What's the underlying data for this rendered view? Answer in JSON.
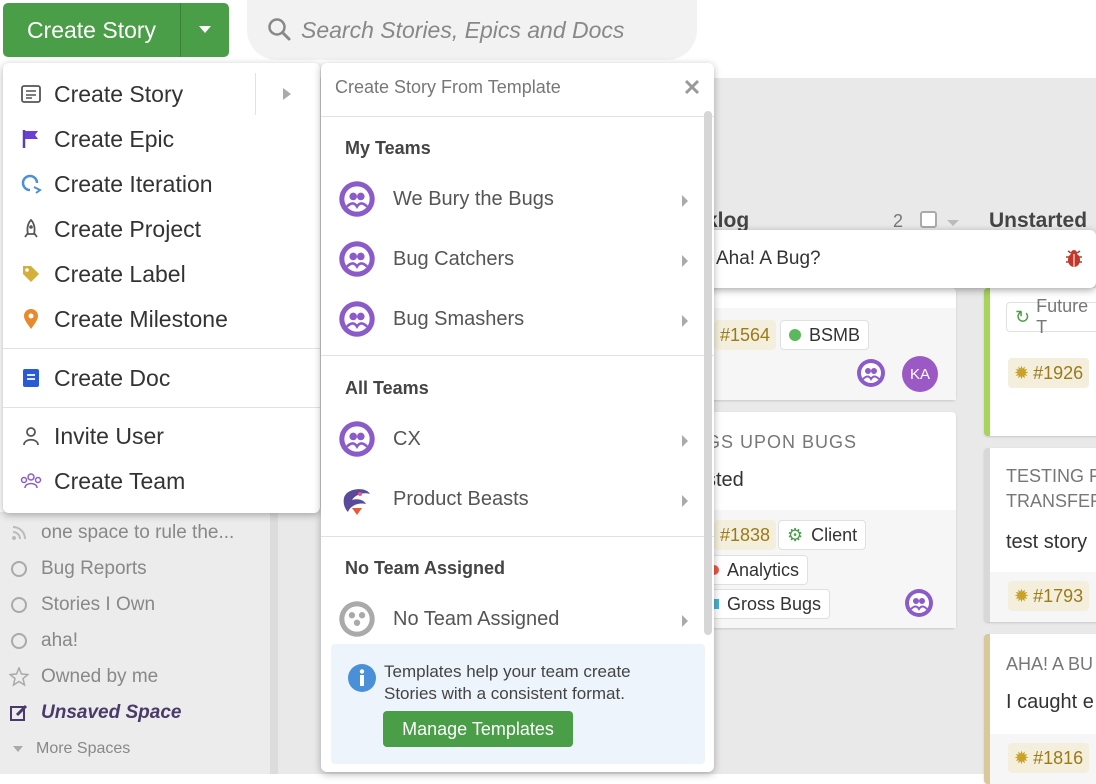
{
  "topbar": {
    "create_label": "Create Story",
    "search_placeholder": "Search Stories, Epics and Docs"
  },
  "create_menu": {
    "items": [
      {
        "label": "Create Story",
        "icon": "story-icon"
      },
      {
        "label": "Create Epic",
        "icon": "epic-flag-icon"
      },
      {
        "label": "Create Iteration",
        "icon": "iteration-icon"
      },
      {
        "label": "Create Project",
        "icon": "rocket-icon"
      },
      {
        "label": "Create Label",
        "icon": "label-tag-icon"
      },
      {
        "label": "Create Milestone",
        "icon": "milestone-pin-icon"
      },
      {
        "label": "Create Doc",
        "icon": "doc-icon"
      },
      {
        "label": "Invite User",
        "icon": "user-icon"
      },
      {
        "label": "Create Team",
        "icon": "team-icon"
      }
    ]
  },
  "template_menu": {
    "title": "Create Story From Template",
    "sections": [
      {
        "title": "My Teams",
        "teams": [
          "We Bury the Bugs",
          "Bug Catchers",
          "Bug Smashers"
        ]
      },
      {
        "title": "All Teams",
        "teams": [
          "CX",
          "Product Beasts"
        ]
      },
      {
        "title": "No Team Assigned",
        "teams": [
          "No Team Assigned"
        ]
      }
    ],
    "info_text": "Templates help your team create Stories with a consistent format.",
    "manage_label": "Manage Templates"
  },
  "sidebar": {
    "items": [
      {
        "label": "one space to rule the...",
        "icon": "rss-icon"
      },
      {
        "label": "Bug Reports",
        "icon": "circle-icon"
      },
      {
        "label": "Stories I Own",
        "icon": "circle-icon"
      },
      {
        "label": "aha!",
        "icon": "circle-icon"
      },
      {
        "label": "Owned by me",
        "icon": "star-icon"
      },
      {
        "label": "Unsaved Space",
        "icon": "edit-icon"
      }
    ],
    "more_label": "More Spaces"
  },
  "board": {
    "backlog": {
      "title_fragment": "klog",
      "count": "2"
    },
    "unstarted": {
      "title": "Unstarted"
    },
    "cards": {
      "c1": {
        "id": "#1564",
        "workflow": "BSMB",
        "avatar": "KA"
      },
      "c2": {
        "epic": "GS UPON BUGS",
        "title": "sted",
        "id": "#1838",
        "labels": [
          "Client",
          "Analytics",
          "Gross Bugs"
        ]
      },
      "u1": {
        "label": "Future T",
        "id": "#1926"
      },
      "u2": {
        "epic_line1": "TESTING F",
        "epic_line2": "TRANSFER",
        "title": "test story",
        "id": "#1793"
      },
      "u3": {
        "epic": "AHA! A BU",
        "title": "I caught e",
        "id": "#1816"
      }
    }
  },
  "tooltip": {
    "text": "Aha! A Bug?"
  },
  "colors": {
    "green": "#4a9e48",
    "purple": "#8b5cc9",
    "gold": "#c9a227"
  }
}
